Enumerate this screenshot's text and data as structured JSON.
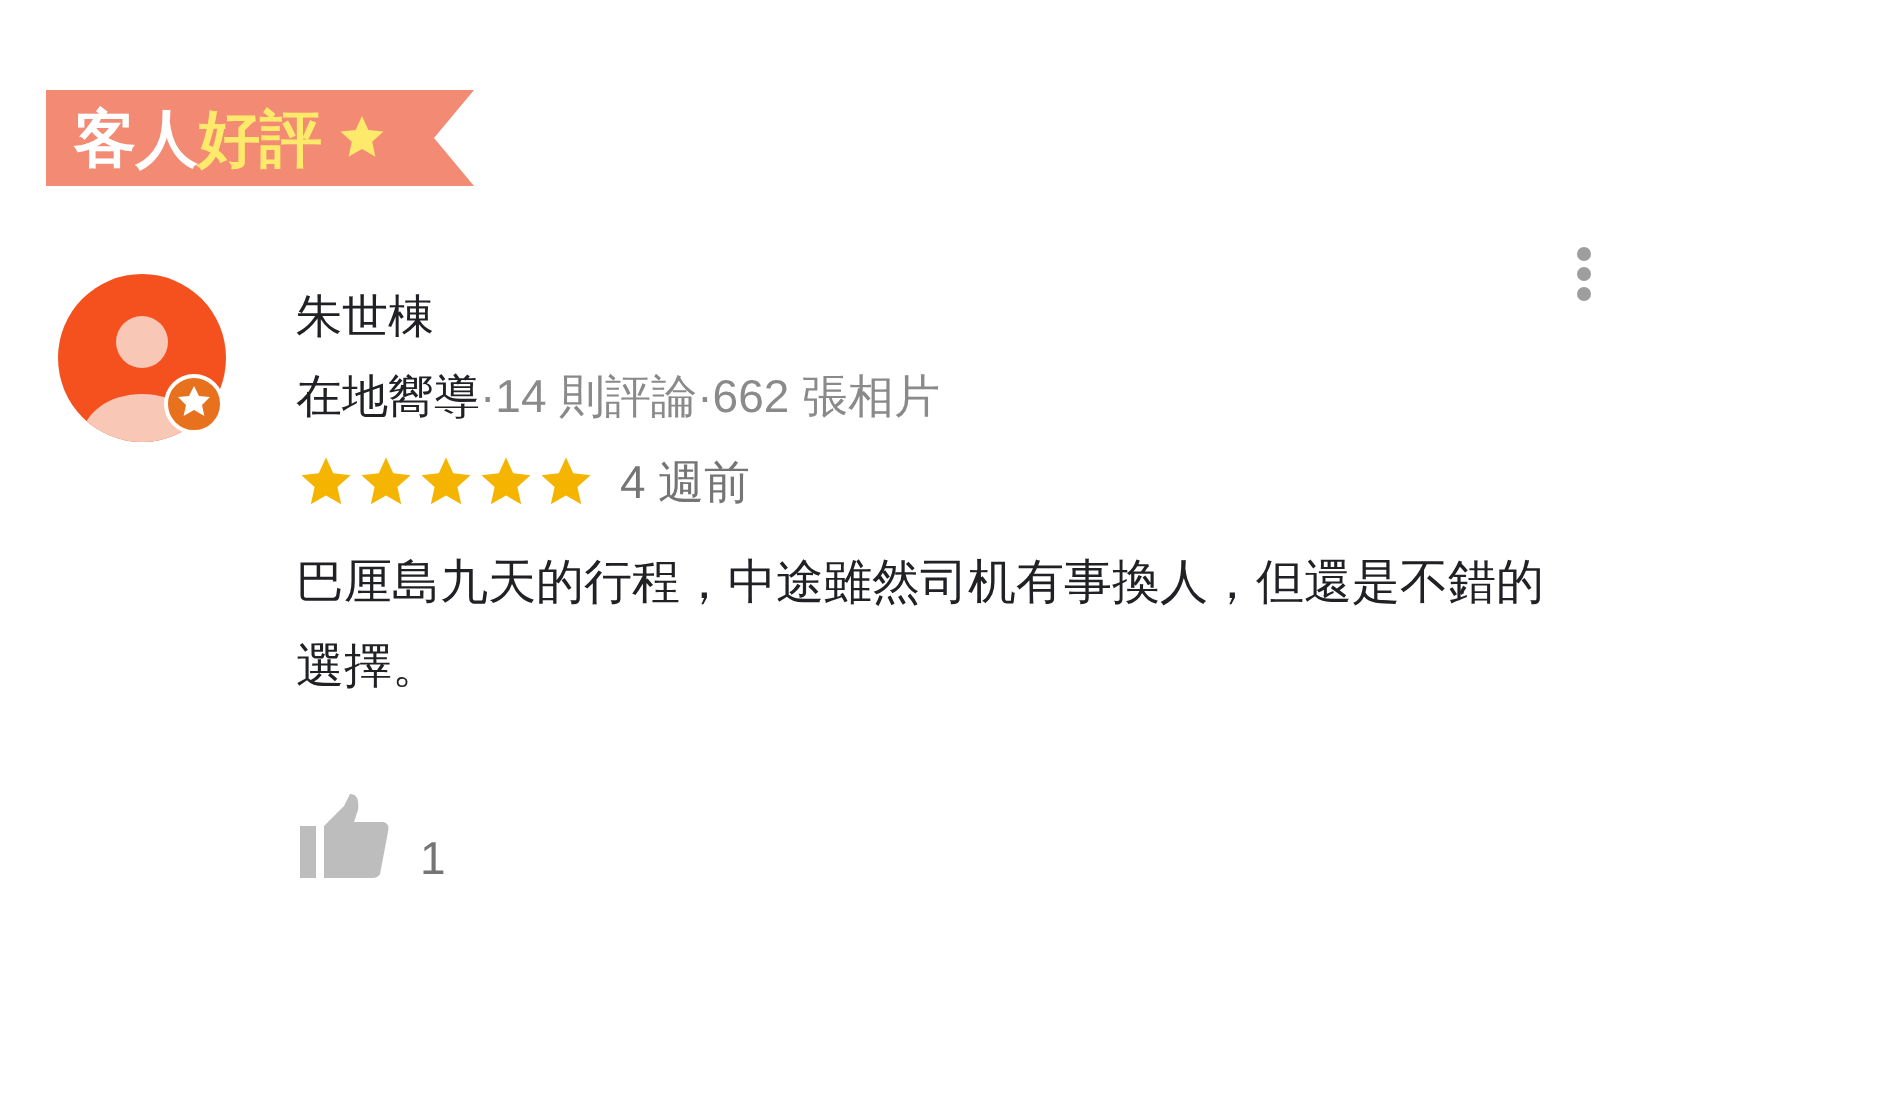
{
  "banner": {
    "title": [
      {
        "text": "客人",
        "color": "#ffffff"
      },
      {
        "text": "好評",
        "color": "#fde96a"
      }
    ]
  },
  "review": {
    "author": "朱世棟",
    "badge": "在地嚮導",
    "stats": [
      "·14 則評論",
      "·662 張相片"
    ],
    "stars": 5,
    "time": "4 週前",
    "text": "巴厘島九天的行程，中途雖然司机有事換人，但還是不錯的選擇。",
    "likes": "1"
  }
}
